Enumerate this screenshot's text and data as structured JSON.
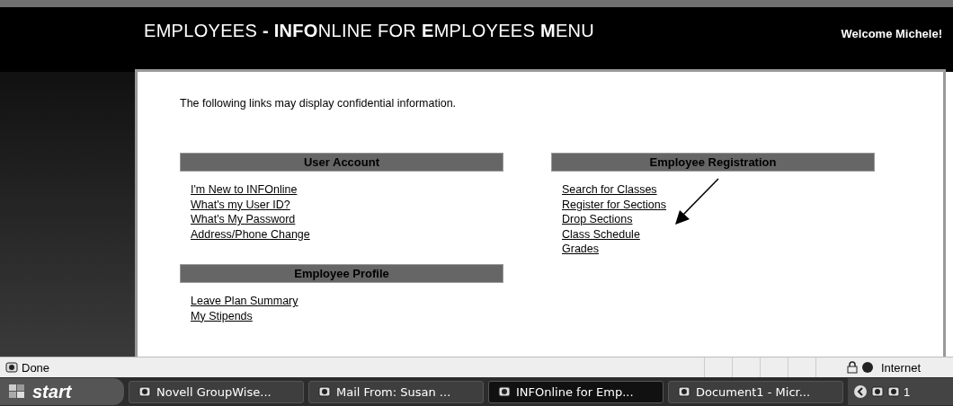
{
  "header": {
    "title": "EMPLOYEES **- INFO**NLINE FOR **E**MPLOYEES **M**ENU",
    "welcome": "Welcome Michele!"
  },
  "notice": "The following links may display confidential information.",
  "columns": [
    {
      "sections": [
        {
          "title": "User Account",
          "links": [
            "I'm New to INFOnline",
            "What's my User ID?",
            "What's My Password",
            "Address/Phone Change"
          ]
        },
        {
          "title": "Employee Profile",
          "links": [
            "Leave Plan Summary",
            "My Stipends"
          ]
        }
      ]
    },
    {
      "sections": [
        {
          "title": "Employee Registration",
          "links": [
            "Search for Classes",
            "Register for Sections",
            "Drop Sections",
            "Class Schedule",
            "Grades"
          ]
        }
      ]
    }
  ],
  "status_bar": {
    "status": "Done",
    "zone": "Internet"
  },
  "taskbar": {
    "start": "start",
    "items": [
      {
        "label": "Novell GroupWise...",
        "selected": false
      },
      {
        "label": "Mail From: Susan ...",
        "selected": false
      },
      {
        "label": "INFOnline for Emp...",
        "selected": true
      },
      {
        "label": "Document1 - Micr...",
        "selected": false
      }
    ],
    "clock": "1"
  }
}
